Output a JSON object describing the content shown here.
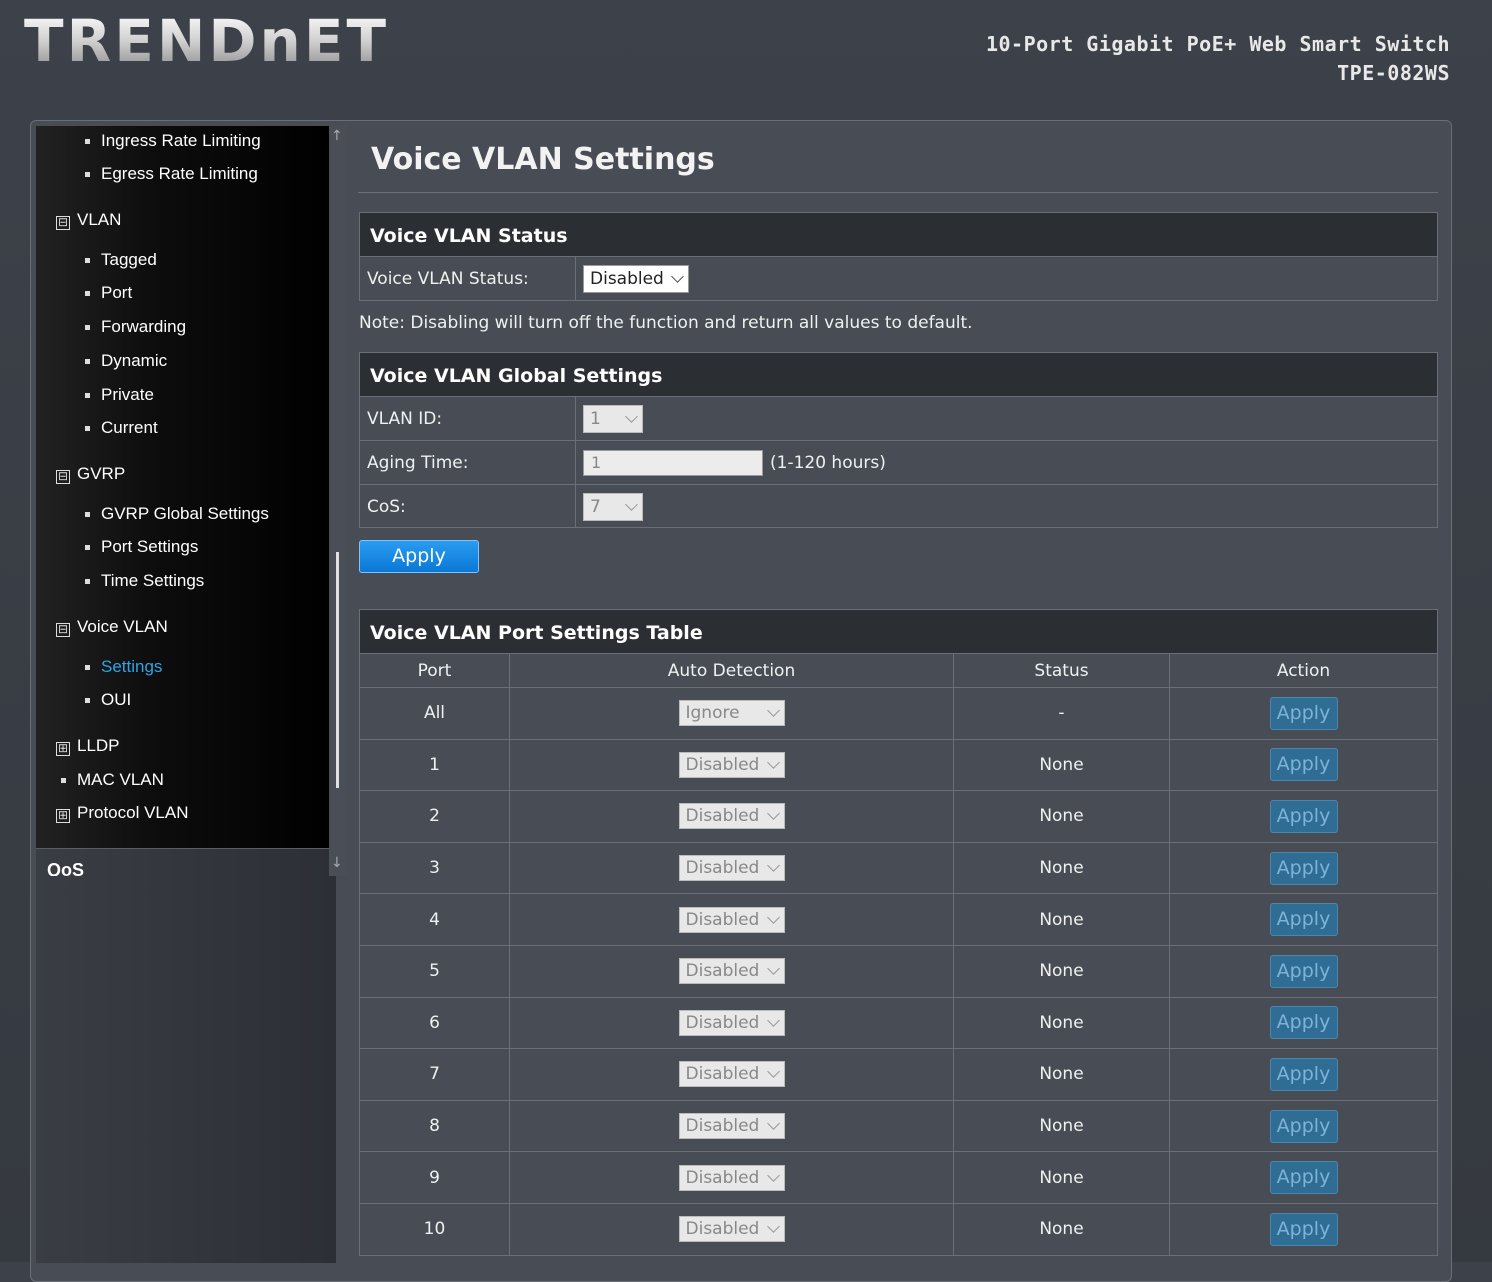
{
  "header": {
    "logo_text": "TRENDnET",
    "product_name": "10-Port Gigabit PoE+ Web Smart Switch",
    "model": "TPE-082WS"
  },
  "sidebar": {
    "items": [
      {
        "label": "Ingress Rate Limiting",
        "type": "sub"
      },
      {
        "label": "Egress Rate Limiting",
        "type": "sub"
      },
      {
        "label": "VLAN",
        "type": "group",
        "expanded": true
      },
      {
        "label": "Tagged",
        "type": "sub"
      },
      {
        "label": "Port",
        "type": "sub"
      },
      {
        "label": "Forwarding",
        "type": "sub"
      },
      {
        "label": "Dynamic",
        "type": "sub"
      },
      {
        "label": "Private",
        "type": "sub"
      },
      {
        "label": "Current",
        "type": "sub"
      },
      {
        "label": "GVRP",
        "type": "group",
        "expanded": true
      },
      {
        "label": "GVRP Global Settings",
        "type": "sub"
      },
      {
        "label": "Port Settings",
        "type": "sub"
      },
      {
        "label": "Time Settings",
        "type": "sub"
      },
      {
        "label": "Voice VLAN",
        "type": "group",
        "expanded": true
      },
      {
        "label": "Settings",
        "type": "sub",
        "active": true
      },
      {
        "label": "OUI",
        "type": "sub"
      },
      {
        "label": "LLDP",
        "type": "group",
        "expanded": false
      },
      {
        "label": "MAC VLAN",
        "type": "item"
      },
      {
        "label": "Protocol VLAN",
        "type": "group",
        "expanded": false
      }
    ],
    "next_section": "QoS",
    "group_expanded_icon": "⊟",
    "group_collapsed_icon": "⊞"
  },
  "page": {
    "title": "Voice VLAN Settings",
    "status_section": {
      "heading": "Voice VLAN Status",
      "label": "Voice VLAN Status:",
      "value": "Disabled"
    },
    "note": "Note: Disabling will turn off the function and return all values to default.",
    "global_section": {
      "heading": "Voice VLAN Global Settings",
      "vlan_id_label": "VLAN ID:",
      "vlan_id_value": "1",
      "aging_label": "Aging Time:",
      "aging_value": "1",
      "aging_hint": "(1-120 hours)",
      "cos_label": "CoS:",
      "cos_value": "7"
    },
    "apply_label": "Apply",
    "port_table": {
      "heading": "Voice VLAN Port Settings Table",
      "columns": [
        "Port",
        "Auto Detection",
        "Status",
        "Action"
      ],
      "rows": [
        {
          "port": "All",
          "detection": "Ignore",
          "status": "-",
          "action": "Apply"
        },
        {
          "port": "1",
          "detection": "Disabled",
          "status": "None",
          "action": "Apply"
        },
        {
          "port": "2",
          "detection": "Disabled",
          "status": "None",
          "action": "Apply"
        },
        {
          "port": "3",
          "detection": "Disabled",
          "status": "None",
          "action": "Apply"
        },
        {
          "port": "4",
          "detection": "Disabled",
          "status": "None",
          "action": "Apply"
        },
        {
          "port": "5",
          "detection": "Disabled",
          "status": "None",
          "action": "Apply"
        },
        {
          "port": "6",
          "detection": "Disabled",
          "status": "None",
          "action": "Apply"
        },
        {
          "port": "7",
          "detection": "Disabled",
          "status": "None",
          "action": "Apply"
        },
        {
          "port": "8",
          "detection": "Disabled",
          "status": "None",
          "action": "Apply"
        },
        {
          "port": "9",
          "detection": "Disabled",
          "status": "None",
          "action": "Apply"
        },
        {
          "port": "10",
          "detection": "Disabled",
          "status": "None",
          "action": "Apply"
        }
      ]
    }
  },
  "colors": {
    "accent_active": "#2fa3e6",
    "apply_button": "#0a78d6",
    "row_apply": "#2f6d95"
  }
}
